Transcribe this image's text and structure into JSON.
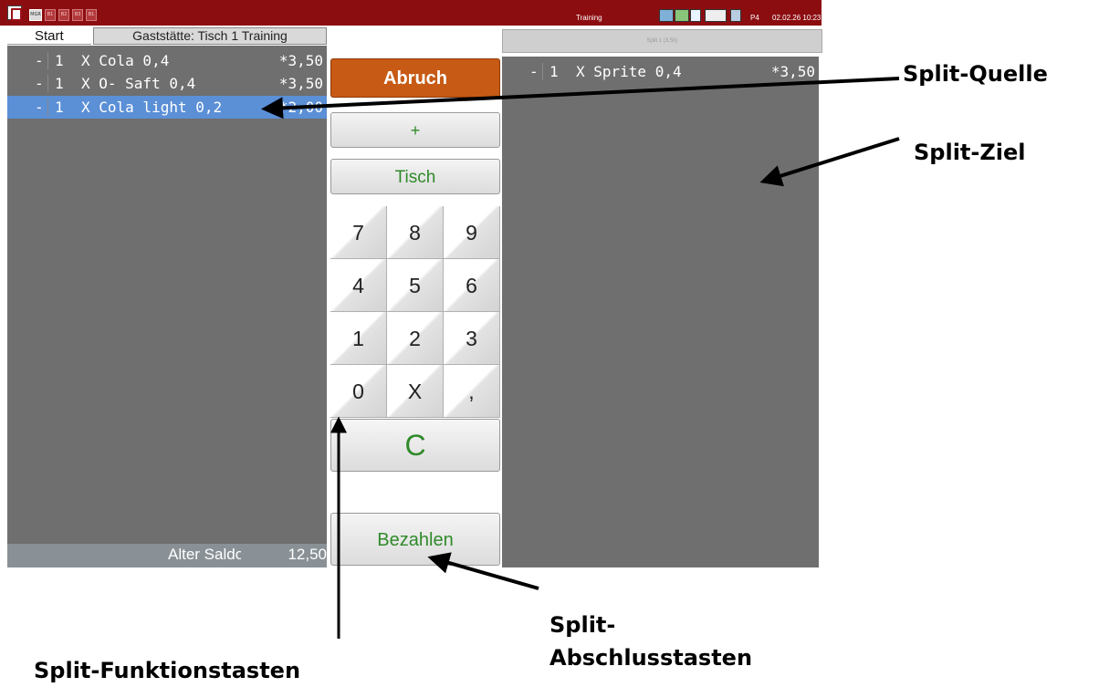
{
  "topbar": {
    "mini_buttons": [
      "MGR",
      "B1",
      "B2",
      "B3",
      "B1"
    ],
    "mode_label": "Training",
    "printer": "P4",
    "datetime": "02.02.26  10:23",
    "bg_color": "#8c0d10"
  },
  "left": {
    "tab_start": "Start",
    "tab_title": "Gaststätte: Tisch 1   Training",
    "items": [
      {
        "dash": "-",
        "qty": "1",
        "name": "X Cola 0,4",
        "price": "*3,50"
      },
      {
        "dash": "-",
        "qty": "1",
        "name": "X O- Saft 0,4",
        "price": "*3,50"
      },
      {
        "dash": "-",
        "qty": "1",
        "name": "X Cola light 0,2",
        "price": "*2,00"
      }
    ],
    "footer_label": "Alter Saldo",
    "footer_value": "12,50"
  },
  "controls": {
    "abruch": "Abruch",
    "plus": "+",
    "tisch": "Tisch",
    "keys": [
      "7",
      "8",
      "9",
      "4",
      "5",
      "6",
      "1",
      "2",
      "3",
      "0",
      "X",
      ","
    ],
    "clear": "C",
    "bezahlen": "Bezahlen"
  },
  "right": {
    "header": "Split 1 (3,50)",
    "items": [
      {
        "dash": "-",
        "qty": "1",
        "name": "X Sprite 0,4",
        "price": "*3,50"
      }
    ]
  },
  "annotations": {
    "split_quelle": "Split-Quelle",
    "split_ziel": "Split-Ziel",
    "split_funktionstasten": "Split-Funktionstasten",
    "split_abschluss_1": "Split-",
    "split_abschluss_2": "Abschlusstasten"
  },
  "colors": {
    "panel": "#6f6f6f",
    "selection": "#5b8fd6",
    "abruch": "#c75a14",
    "button_text": "#2f8a2a"
  }
}
